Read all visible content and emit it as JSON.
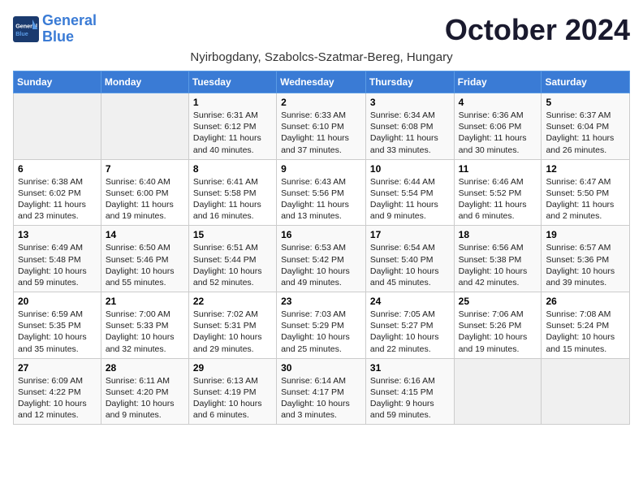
{
  "header": {
    "logo_line1": "General",
    "logo_line2": "Blue",
    "month": "October 2024",
    "location": "Nyirbogdany, Szabolcs-Szatmar-Bereg, Hungary"
  },
  "days_of_week": [
    "Sunday",
    "Monday",
    "Tuesday",
    "Wednesday",
    "Thursday",
    "Friday",
    "Saturday"
  ],
  "weeks": [
    [
      {
        "day": "",
        "info": ""
      },
      {
        "day": "",
        "info": ""
      },
      {
        "day": "1",
        "info": "Sunrise: 6:31 AM\nSunset: 6:12 PM\nDaylight: 11 hours and 40 minutes."
      },
      {
        "day": "2",
        "info": "Sunrise: 6:33 AM\nSunset: 6:10 PM\nDaylight: 11 hours and 37 minutes."
      },
      {
        "day": "3",
        "info": "Sunrise: 6:34 AM\nSunset: 6:08 PM\nDaylight: 11 hours and 33 minutes."
      },
      {
        "day": "4",
        "info": "Sunrise: 6:36 AM\nSunset: 6:06 PM\nDaylight: 11 hours and 30 minutes."
      },
      {
        "day": "5",
        "info": "Sunrise: 6:37 AM\nSunset: 6:04 PM\nDaylight: 11 hours and 26 minutes."
      }
    ],
    [
      {
        "day": "6",
        "info": "Sunrise: 6:38 AM\nSunset: 6:02 PM\nDaylight: 11 hours and 23 minutes."
      },
      {
        "day": "7",
        "info": "Sunrise: 6:40 AM\nSunset: 6:00 PM\nDaylight: 11 hours and 19 minutes."
      },
      {
        "day": "8",
        "info": "Sunrise: 6:41 AM\nSunset: 5:58 PM\nDaylight: 11 hours and 16 minutes."
      },
      {
        "day": "9",
        "info": "Sunrise: 6:43 AM\nSunset: 5:56 PM\nDaylight: 11 hours and 13 minutes."
      },
      {
        "day": "10",
        "info": "Sunrise: 6:44 AM\nSunset: 5:54 PM\nDaylight: 11 hours and 9 minutes."
      },
      {
        "day": "11",
        "info": "Sunrise: 6:46 AM\nSunset: 5:52 PM\nDaylight: 11 hours and 6 minutes."
      },
      {
        "day": "12",
        "info": "Sunrise: 6:47 AM\nSunset: 5:50 PM\nDaylight: 11 hours and 2 minutes."
      }
    ],
    [
      {
        "day": "13",
        "info": "Sunrise: 6:49 AM\nSunset: 5:48 PM\nDaylight: 10 hours and 59 minutes."
      },
      {
        "day": "14",
        "info": "Sunrise: 6:50 AM\nSunset: 5:46 PM\nDaylight: 10 hours and 55 minutes."
      },
      {
        "day": "15",
        "info": "Sunrise: 6:51 AM\nSunset: 5:44 PM\nDaylight: 10 hours and 52 minutes."
      },
      {
        "day": "16",
        "info": "Sunrise: 6:53 AM\nSunset: 5:42 PM\nDaylight: 10 hours and 49 minutes."
      },
      {
        "day": "17",
        "info": "Sunrise: 6:54 AM\nSunset: 5:40 PM\nDaylight: 10 hours and 45 minutes."
      },
      {
        "day": "18",
        "info": "Sunrise: 6:56 AM\nSunset: 5:38 PM\nDaylight: 10 hours and 42 minutes."
      },
      {
        "day": "19",
        "info": "Sunrise: 6:57 AM\nSunset: 5:36 PM\nDaylight: 10 hours and 39 minutes."
      }
    ],
    [
      {
        "day": "20",
        "info": "Sunrise: 6:59 AM\nSunset: 5:35 PM\nDaylight: 10 hours and 35 minutes."
      },
      {
        "day": "21",
        "info": "Sunrise: 7:00 AM\nSunset: 5:33 PM\nDaylight: 10 hours and 32 minutes."
      },
      {
        "day": "22",
        "info": "Sunrise: 7:02 AM\nSunset: 5:31 PM\nDaylight: 10 hours and 29 minutes."
      },
      {
        "day": "23",
        "info": "Sunrise: 7:03 AM\nSunset: 5:29 PM\nDaylight: 10 hours and 25 minutes."
      },
      {
        "day": "24",
        "info": "Sunrise: 7:05 AM\nSunset: 5:27 PM\nDaylight: 10 hours and 22 minutes."
      },
      {
        "day": "25",
        "info": "Sunrise: 7:06 AM\nSunset: 5:26 PM\nDaylight: 10 hours and 19 minutes."
      },
      {
        "day": "26",
        "info": "Sunrise: 7:08 AM\nSunset: 5:24 PM\nDaylight: 10 hours and 15 minutes."
      }
    ],
    [
      {
        "day": "27",
        "info": "Sunrise: 6:09 AM\nSunset: 4:22 PM\nDaylight: 10 hours and 12 minutes."
      },
      {
        "day": "28",
        "info": "Sunrise: 6:11 AM\nSunset: 4:20 PM\nDaylight: 10 hours and 9 minutes."
      },
      {
        "day": "29",
        "info": "Sunrise: 6:13 AM\nSunset: 4:19 PM\nDaylight: 10 hours and 6 minutes."
      },
      {
        "day": "30",
        "info": "Sunrise: 6:14 AM\nSunset: 4:17 PM\nDaylight: 10 hours and 3 minutes."
      },
      {
        "day": "31",
        "info": "Sunrise: 6:16 AM\nSunset: 4:15 PM\nDaylight: 9 hours and 59 minutes."
      },
      {
        "day": "",
        "info": ""
      },
      {
        "day": "",
        "info": ""
      }
    ]
  ]
}
